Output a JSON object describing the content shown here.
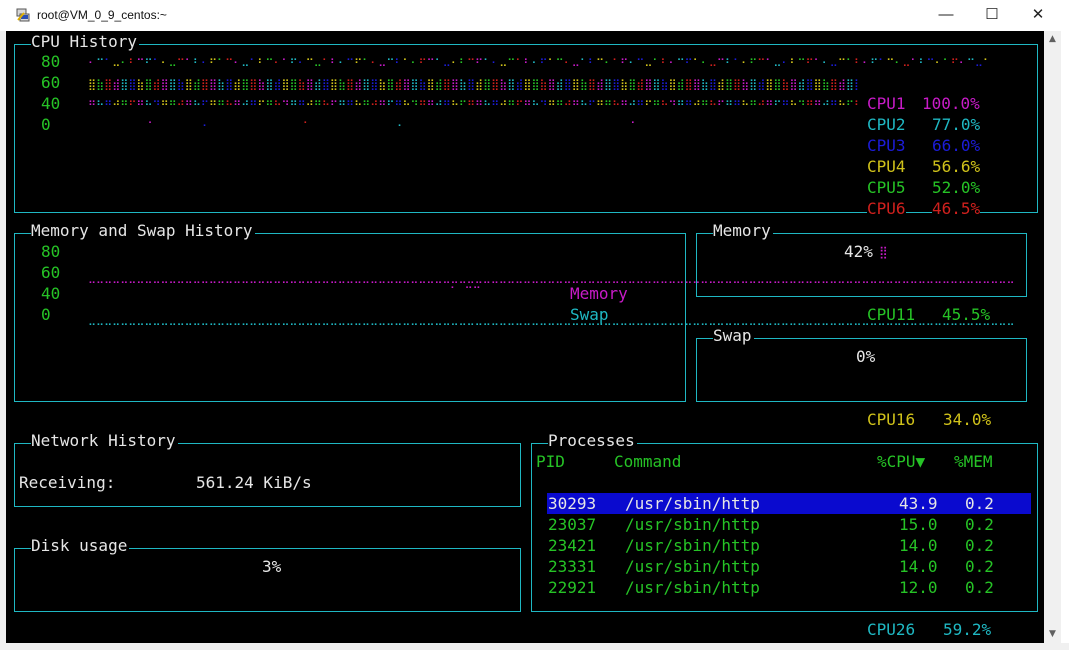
{
  "window": {
    "title": "root@VM_0_9_centos:~",
    "minimize_glyph": "—",
    "maximize_glyph": "☐",
    "close_glyph": "✕"
  },
  "cpu_history": {
    "title": "CPU History",
    "axis": [
      "80",
      "60",
      "40",
      "0"
    ],
    "cpus": [
      {
        "label": "CPU1",
        "value": "100.0%",
        "color": "#c81bc8"
      },
      {
        "label": "CPU2",
        "value": "77.0%",
        "color": "#1fb8c3"
      },
      {
        "label": "CPU3",
        "value": "66.0%",
        "color": "#1c1cd8"
      },
      {
        "label": "CPU4",
        "value": "56.6%",
        "color": "#d0c21a"
      },
      {
        "label": "CPU5",
        "value": "52.0%",
        "color": "#26c326"
      },
      {
        "label": "CPU6",
        "value": "46.5%",
        "color": "#d0201d"
      }
    ]
  },
  "memory_history": {
    "title": "Memory and Swap History",
    "axis": [
      "80",
      "60",
      "40",
      "0"
    ],
    "legend": [
      {
        "label": "Memory",
        "color": "#c81bc8"
      },
      {
        "label": "Swap",
        "color": "#1fb8c3"
      }
    ]
  },
  "memory": {
    "title": "Memory",
    "percent": "42%"
  },
  "swap": {
    "title": "Swap",
    "percent": "0%"
  },
  "extra_cpus": [
    {
      "label": "CPU11",
      "value": "45.5%",
      "color": "#26c326"
    },
    {
      "label": "CPU16",
      "value": "34.0%",
      "color": "#d0c21a"
    },
    {
      "label": "CPU26",
      "value": "59.2%",
      "color": "#1fb8c3"
    }
  ],
  "network": {
    "title": "Network History",
    "receiving_label": "Receiving:",
    "receiving_value": "561.24 KiB/s"
  },
  "disk": {
    "title": "Disk usage",
    "percent": "3%"
  },
  "processes": {
    "title": "Processes",
    "headers": {
      "pid": "PID",
      "command": "Command",
      "cpu": "%CPU▼",
      "mem": "%MEM"
    },
    "rows": [
      {
        "pid": "30293",
        "command": "/usr/sbin/http",
        "cpu": "43.9",
        "mem": "0.2"
      },
      {
        "pid": "23037",
        "command": "/usr/sbin/http",
        "cpu": "15.0",
        "mem": "0.2"
      },
      {
        "pid": "23421",
        "command": "/usr/sbin/http",
        "cpu": "14.0",
        "mem": "0.2"
      },
      {
        "pid": "23331",
        "command": "/usr/sbin/http",
        "cpu": "14.0",
        "mem": "0.2"
      },
      {
        "pid": "22921",
        "command": "/usr/sbin/http",
        "cpu": "12.0",
        "mem": "0.2"
      }
    ],
    "selected_index": 0
  },
  "colors": {
    "border": "#1fb8c3",
    "green": "#26c326",
    "selection": "#0a0acf",
    "text": "#e6e6e6"
  }
}
